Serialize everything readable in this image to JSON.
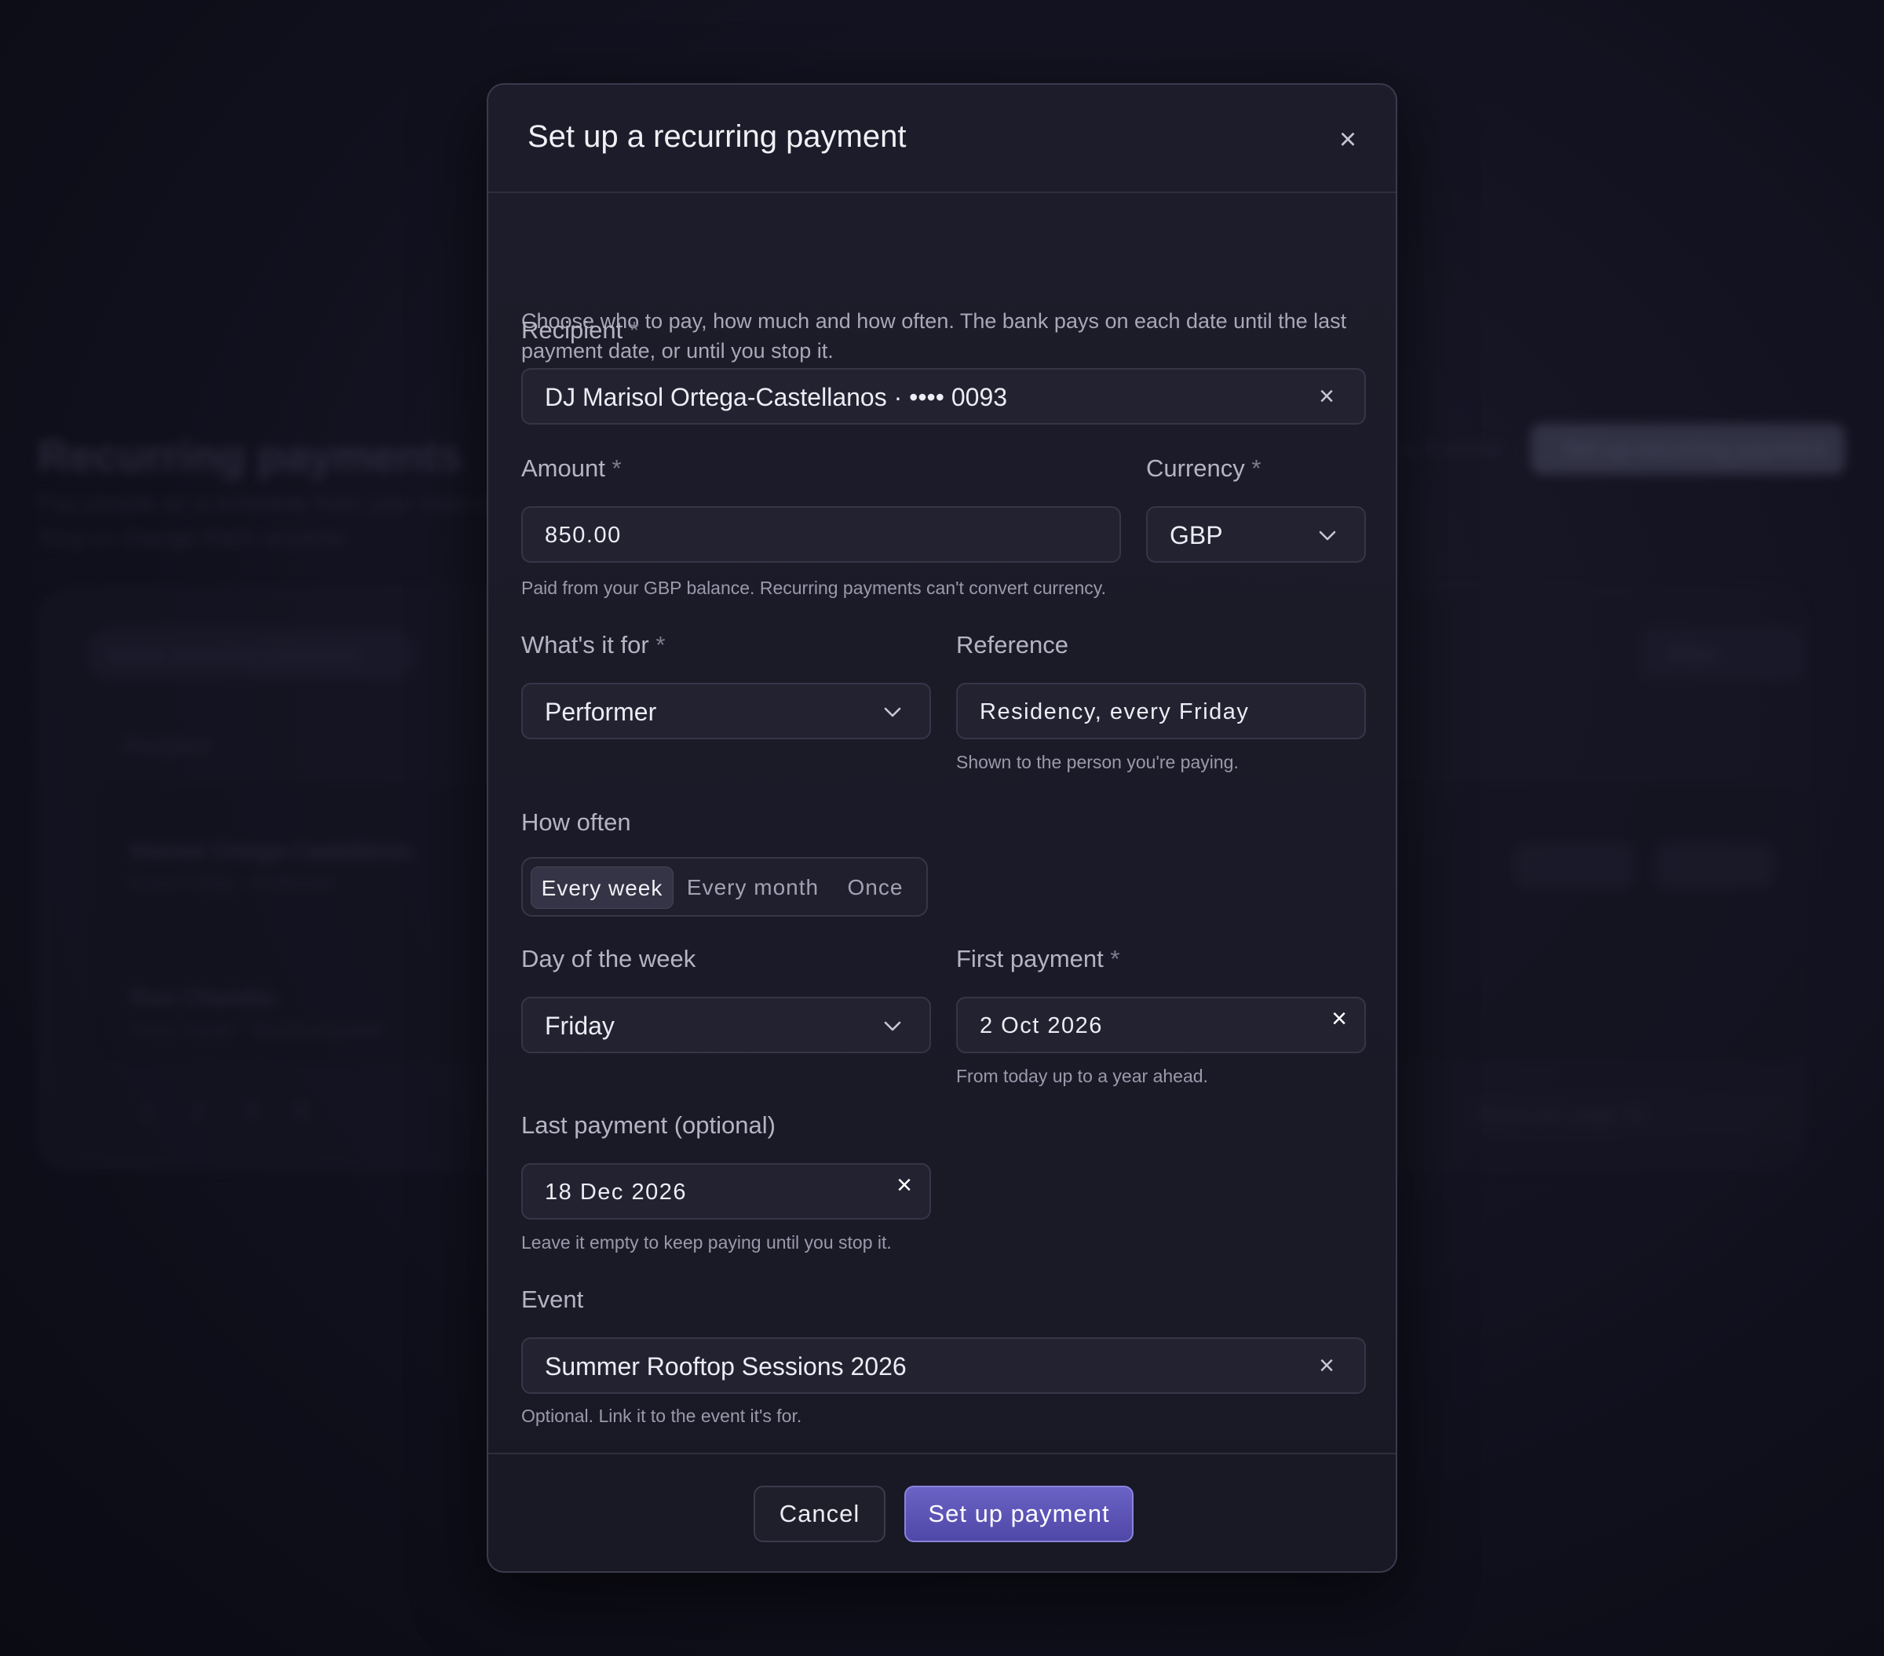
{
  "background": {
    "page_title": "Recurring payments",
    "subtitle_line1": "Pay people on a schedule from your balance.",
    "subtitle_line2": "Stop or change them anytime.",
    "header_link": "How it works",
    "primary_action": "Set up recurring payment",
    "tab": "Active recurring payments",
    "filter": "Filter",
    "column": "Recipient",
    "rows": [
      {
        "title": "Marisol Ortega-Castellanos",
        "meta": "Every Friday · Performer"
      },
      {
        "title": "Ravi Chandra",
        "meta": "Every month · Sound engineer"
      }
    ],
    "row_actions": [
      "Pause",
      "Edit"
    ],
    "pages": [
      "1",
      "2",
      "3",
      "4"
    ],
    "per_page": "Rows per page 10"
  },
  "dialog": {
    "title": "Set up a recurring payment",
    "intro": "Choose who to pay, how much and how often. The bank pays on each date until the last payment date, or until you stop it.",
    "recipient": {
      "label": "Recipient",
      "required": "*",
      "value": "DJ Marisol Ortega-Castellanos · •••• 0093"
    },
    "amount": {
      "label": "Amount",
      "required": "*",
      "value": "850.00",
      "hint": "Paid from your GBP balance. Recurring payments can't convert currency."
    },
    "currency": {
      "label": "Currency",
      "required": "*",
      "value": "GBP"
    },
    "purpose": {
      "label": "What's it for",
      "required": "*",
      "value": "Performer"
    },
    "reference": {
      "label": "Reference",
      "value": "Residency, every Friday",
      "hint": "Shown to the person you're paying."
    },
    "frequency": {
      "label": "How often",
      "options": [
        "Every week",
        "Every month",
        "Once"
      ],
      "selected": "Every week"
    },
    "day_of_week": {
      "label": "Day of the week",
      "value": "Friday"
    },
    "first_payment": {
      "label": "First payment",
      "required": "*",
      "value": "2 Oct 2026",
      "hint": "From today up to a year ahead."
    },
    "last_payment": {
      "label": "Last payment (optional)",
      "value": "18 Dec 2026",
      "hint": "Leave it empty to keep paying until you stop it."
    },
    "event": {
      "label": "Event",
      "value": "Summer Rooftop Sessions 2026",
      "hint": "Optional. Link it to the event it's for."
    },
    "cancel_label": "Cancel",
    "submit_label": "Set up payment",
    "close_glyph": "×",
    "clear_glyph": "×",
    "accent_color": "#5b54b8"
  }
}
